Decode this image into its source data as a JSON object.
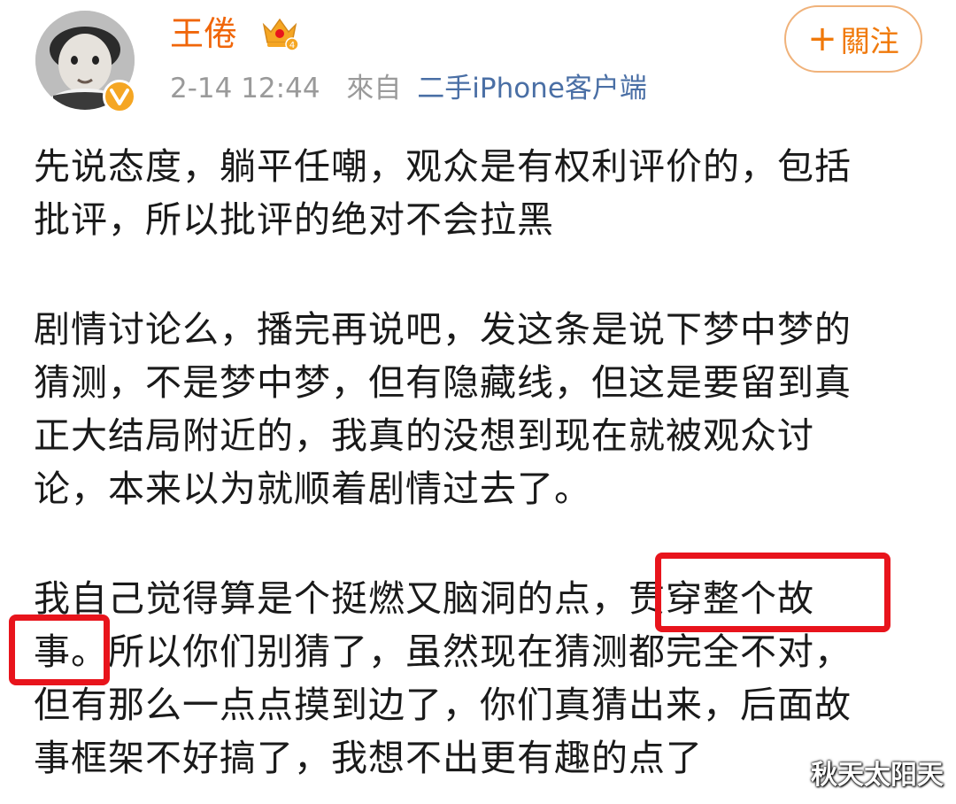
{
  "post": {
    "author": {
      "name": "王倦",
      "avatar_icon": "child-photo-avatar",
      "verified_icon": "verified-v-badge",
      "level_icon": "crown-icon"
    },
    "time": "2-14 12:44",
    "from_label": "來自",
    "source": "二手iPhone客户端",
    "follow_button": {
      "plus": "+",
      "label": "關注"
    },
    "paragraphs": [
      {
        "lines": [
          "先说态度，躺平任嘲，观众是有权利评价的，包括",
          "批评，所以批评的绝对不会拉黑"
        ]
      },
      {
        "lines": [
          "剧情讨论么，播完再说吧，发这条是说下梦中梦的",
          "猜测，不是梦中梦，但有隐藏线，但这是要留到真",
          "正大结局附近的，我真的没想到现在就被观众讨",
          "论，本来以为就顺着剧情过去了。"
        ]
      },
      {
        "lines": [
          "我自己觉得算是个挺燃又脑洞的点，贯穿整个故",
          "事。所以你们别猜了，虽然现在猜测都完全不对，",
          "但有那么一点点摸到边了，你们真猜出来，后面故",
          "事框架不好搞了，我想不出更有趣的点了"
        ]
      }
    ]
  },
  "highlights": {
    "color": "#e8141c",
    "boxes": [
      "贯穿整个故",
      "事。"
    ]
  },
  "watermark": "秋天太阳天",
  "colors": {
    "username": "#f0660a",
    "source_link": "#4a6fa5",
    "follow_border": "#f0b27a",
    "follow_text": "#f0790a",
    "meta_text": "#9a9a9a",
    "body_text": "#1a1a1a"
  }
}
